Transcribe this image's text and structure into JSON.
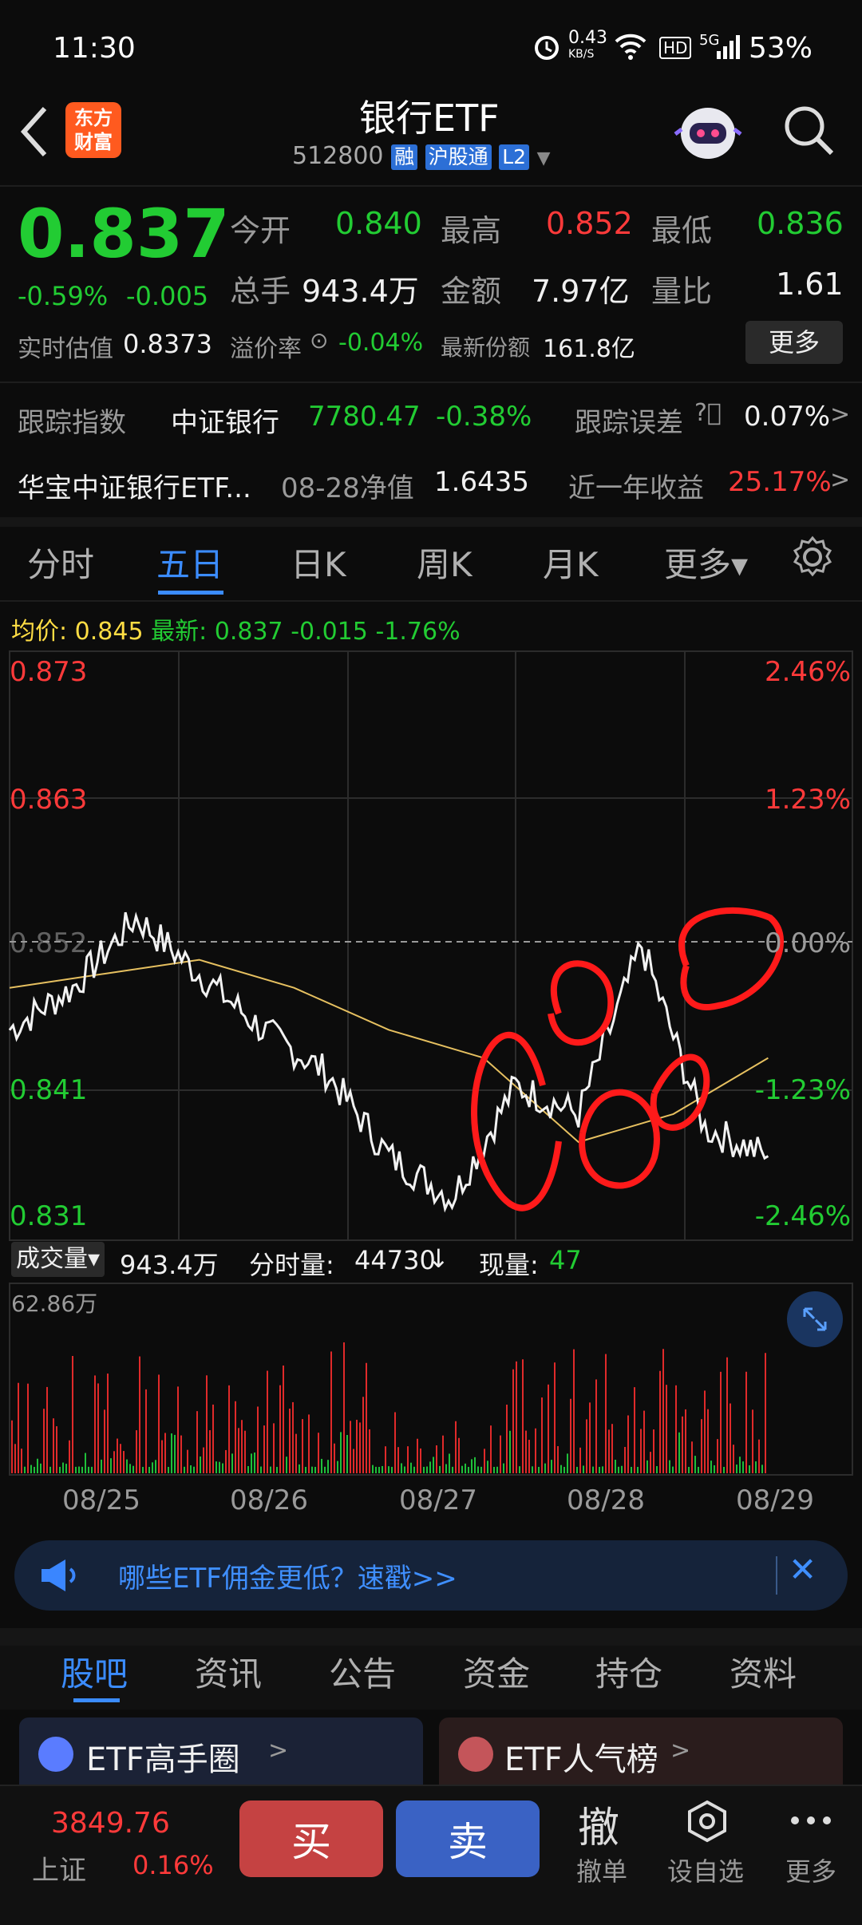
{
  "status_bar": {
    "time": "11:30",
    "net_speed_top": "0.43",
    "net_speed_bottom": "KB/S",
    "hd": "HD",
    "signal": "5G",
    "battery": "53%"
  },
  "header": {
    "logo_line1": "东方",
    "logo_line2": "财富",
    "title": "银行ETF",
    "code": "512800",
    "tag_rong": "融",
    "tag_hgt": "沪股通",
    "tag_l2": "L2"
  },
  "quote": {
    "price": "0.837",
    "change_pct": "-0.59%",
    "change": "-0.005",
    "open_label": "今开",
    "open": "0.840",
    "high_label": "最高",
    "high": "0.852",
    "low_label": "最低",
    "low": "0.836",
    "vol_label": "总手",
    "vol": "943.4万",
    "amt_label": "金额",
    "amt": "7.97亿",
    "ratio_label": "量比",
    "ratio": "1.61",
    "est_label": "实时估值",
    "est": "0.8373",
    "prem_label": "溢价率",
    "prem": "-0.04%",
    "shares_label": "最新份额",
    "shares": "161.8亿",
    "more": "更多"
  },
  "tracking": {
    "label": "跟踪指数",
    "index": "中证银行",
    "value": "7780.47",
    "pct": "-0.38%",
    "err_label": "跟踪误差",
    "err": "0.07%",
    "arrow": ">"
  },
  "fund": {
    "name": "华宝中证银行ETF...",
    "nav_label": "08-28净值",
    "nav": "1.6435",
    "ret_label": "近一年收益",
    "ret": "25.17%",
    "arrow": ">"
  },
  "chart_tabs": [
    {
      "label": "分时"
    },
    {
      "label": "五日"
    },
    {
      "label": "日K"
    },
    {
      "label": "周K"
    },
    {
      "label": "月K"
    },
    {
      "label": "更多▾"
    }
  ],
  "legend": {
    "avg_label": "均价:",
    "avg": "0.845",
    "last_label": "最新:",
    "last": "0.837",
    "chg": "-0.015",
    "pct": "-1.76%"
  },
  "y_labels_left": [
    "0.873",
    "0.863",
    "0.852",
    "0.841",
    "0.831"
  ],
  "y_labels_right": [
    "2.46%",
    "1.23%",
    "0.00%",
    "-1.23%",
    "-2.46%"
  ],
  "volume_bar": {
    "tab": "成交量▾",
    "total": "943.4万",
    "minute_label": "分时量:",
    "minute": "44730",
    "arrow": "↓",
    "now_label": "现量:",
    "now": "47",
    "max": "62.86万"
  },
  "dates": [
    "08/25",
    "08/26",
    "08/27",
    "08/28",
    "08/29"
  ],
  "chart_data": {
    "type": "line",
    "title": "五日",
    "x": [
      "08/25",
      "08/26",
      "08/27",
      "08/28",
      "08/29"
    ],
    "series": [
      {
        "name": "最新",
        "values": [
          0.846,
          0.849,
          0.854,
          0.85,
          0.846,
          0.843,
          0.837,
          0.834,
          0.842,
          0.84,
          0.852,
          0.839,
          0.837
        ]
      },
      {
        "name": "均价",
        "values": [
          0.849,
          0.85,
          0.851,
          0.849,
          0.846,
          0.844,
          0.838,
          0.84,
          0.844
        ]
      }
    ],
    "ylim": [
      0.831,
      0.873
    ],
    "y_ref": 0.852
  },
  "banner": {
    "text": "哪些ETF佣金更低？速戳>>",
    "close": "✕"
  },
  "bottom_tabs": [
    {
      "label": "股吧"
    },
    {
      "label": "资讯"
    },
    {
      "label": "公告"
    },
    {
      "label": "资金"
    },
    {
      "label": "持仓"
    },
    {
      "label": "资料"
    }
  ],
  "cards": {
    "left": "ETF高手圈",
    "right": "ETF人气榜",
    "arrow": ">"
  },
  "bottom_bar": {
    "index_value": "3849.76",
    "index_name": "上证",
    "index_pct": "0.16%",
    "buy": "买",
    "sell": "卖",
    "cancel_icon": "撤",
    "cancel": "撤单",
    "watch": "设自选",
    "more": "更多"
  }
}
